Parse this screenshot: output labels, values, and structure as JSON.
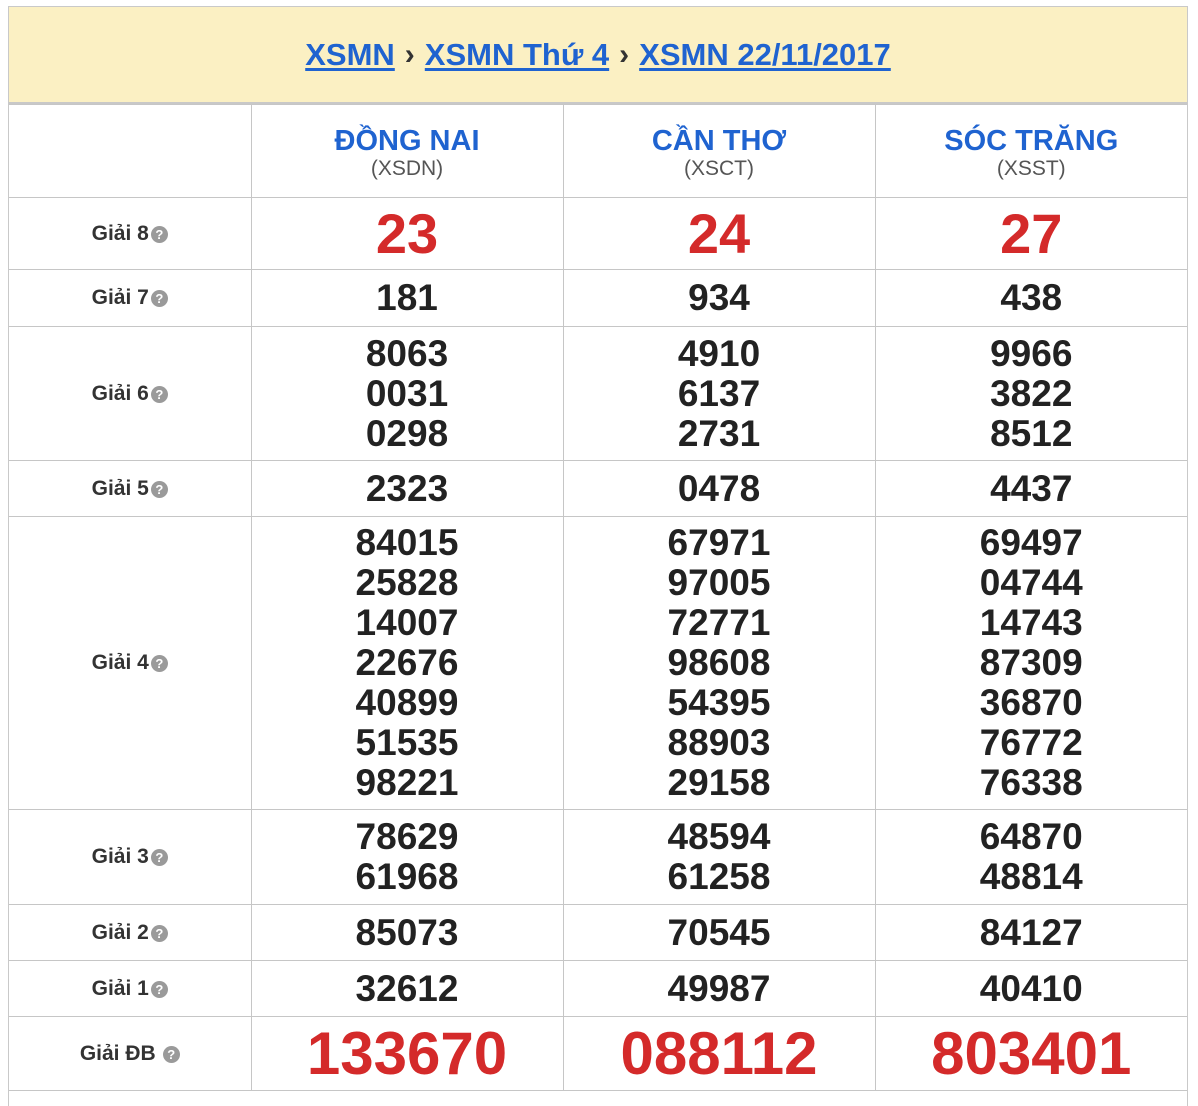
{
  "breadcrumb": {
    "items": [
      "XSMN",
      "XSMN Thứ 4",
      "XSMN 22/11/2017"
    ],
    "separator": "›"
  },
  "provinces": [
    {
      "name": "ĐỒNG NAI",
      "code": "(XSDN)"
    },
    {
      "name": "CẦN THƠ",
      "code": "(XSCT)"
    },
    {
      "name": "SÓC TRĂNG",
      "code": "(XSST)"
    }
  ],
  "prizes": [
    {
      "label": "Giải 8",
      "style": "big8",
      "values": [
        [
          "23"
        ],
        [
          "24"
        ],
        [
          "27"
        ]
      ]
    },
    {
      "label": "Giải 7",
      "style": "num",
      "values": [
        [
          "181"
        ],
        [
          "934"
        ],
        [
          "438"
        ]
      ]
    },
    {
      "label": "Giải 6",
      "style": "num",
      "values": [
        [
          "8063",
          "0031",
          "0298"
        ],
        [
          "4910",
          "6137",
          "2731"
        ],
        [
          "9966",
          "3822",
          "8512"
        ]
      ]
    },
    {
      "label": "Giải 5",
      "style": "num",
      "values": [
        [
          "2323"
        ],
        [
          "0478"
        ],
        [
          "4437"
        ]
      ]
    },
    {
      "label": "Giải 4",
      "style": "num",
      "values": [
        [
          "84015",
          "25828",
          "14007",
          "22676",
          "40899",
          "51535",
          "98221"
        ],
        [
          "67971",
          "97005",
          "72771",
          "98608",
          "54395",
          "88903",
          "29158"
        ],
        [
          "69497",
          "04744",
          "14743",
          "87309",
          "36870",
          "76772",
          "76338"
        ]
      ]
    },
    {
      "label": "Giải 3",
      "style": "num",
      "values": [
        [
          "78629",
          "61968"
        ],
        [
          "48594",
          "61258"
        ],
        [
          "64870",
          "48814"
        ]
      ]
    },
    {
      "label": "Giải 2",
      "style": "num",
      "values": [
        [
          "85073"
        ],
        [
          "70545"
        ],
        [
          "84127"
        ]
      ]
    },
    {
      "label": "Giải 1",
      "style": "num",
      "values": [
        [
          "32612"
        ],
        [
          "49987"
        ],
        [
          "40410"
        ]
      ]
    },
    {
      "label": "Giải ĐB",
      "style": "bigdb",
      "values": [
        [
          "133670"
        ],
        [
          "088112"
        ],
        [
          "803401"
        ]
      ]
    }
  ],
  "help_icon": {
    "name": "question-circle-icon",
    "glyph": "?"
  },
  "colors": {
    "link": "#1f63d0",
    "accent_red": "#d42a2a",
    "header_bg": "#fbf0c3"
  }
}
